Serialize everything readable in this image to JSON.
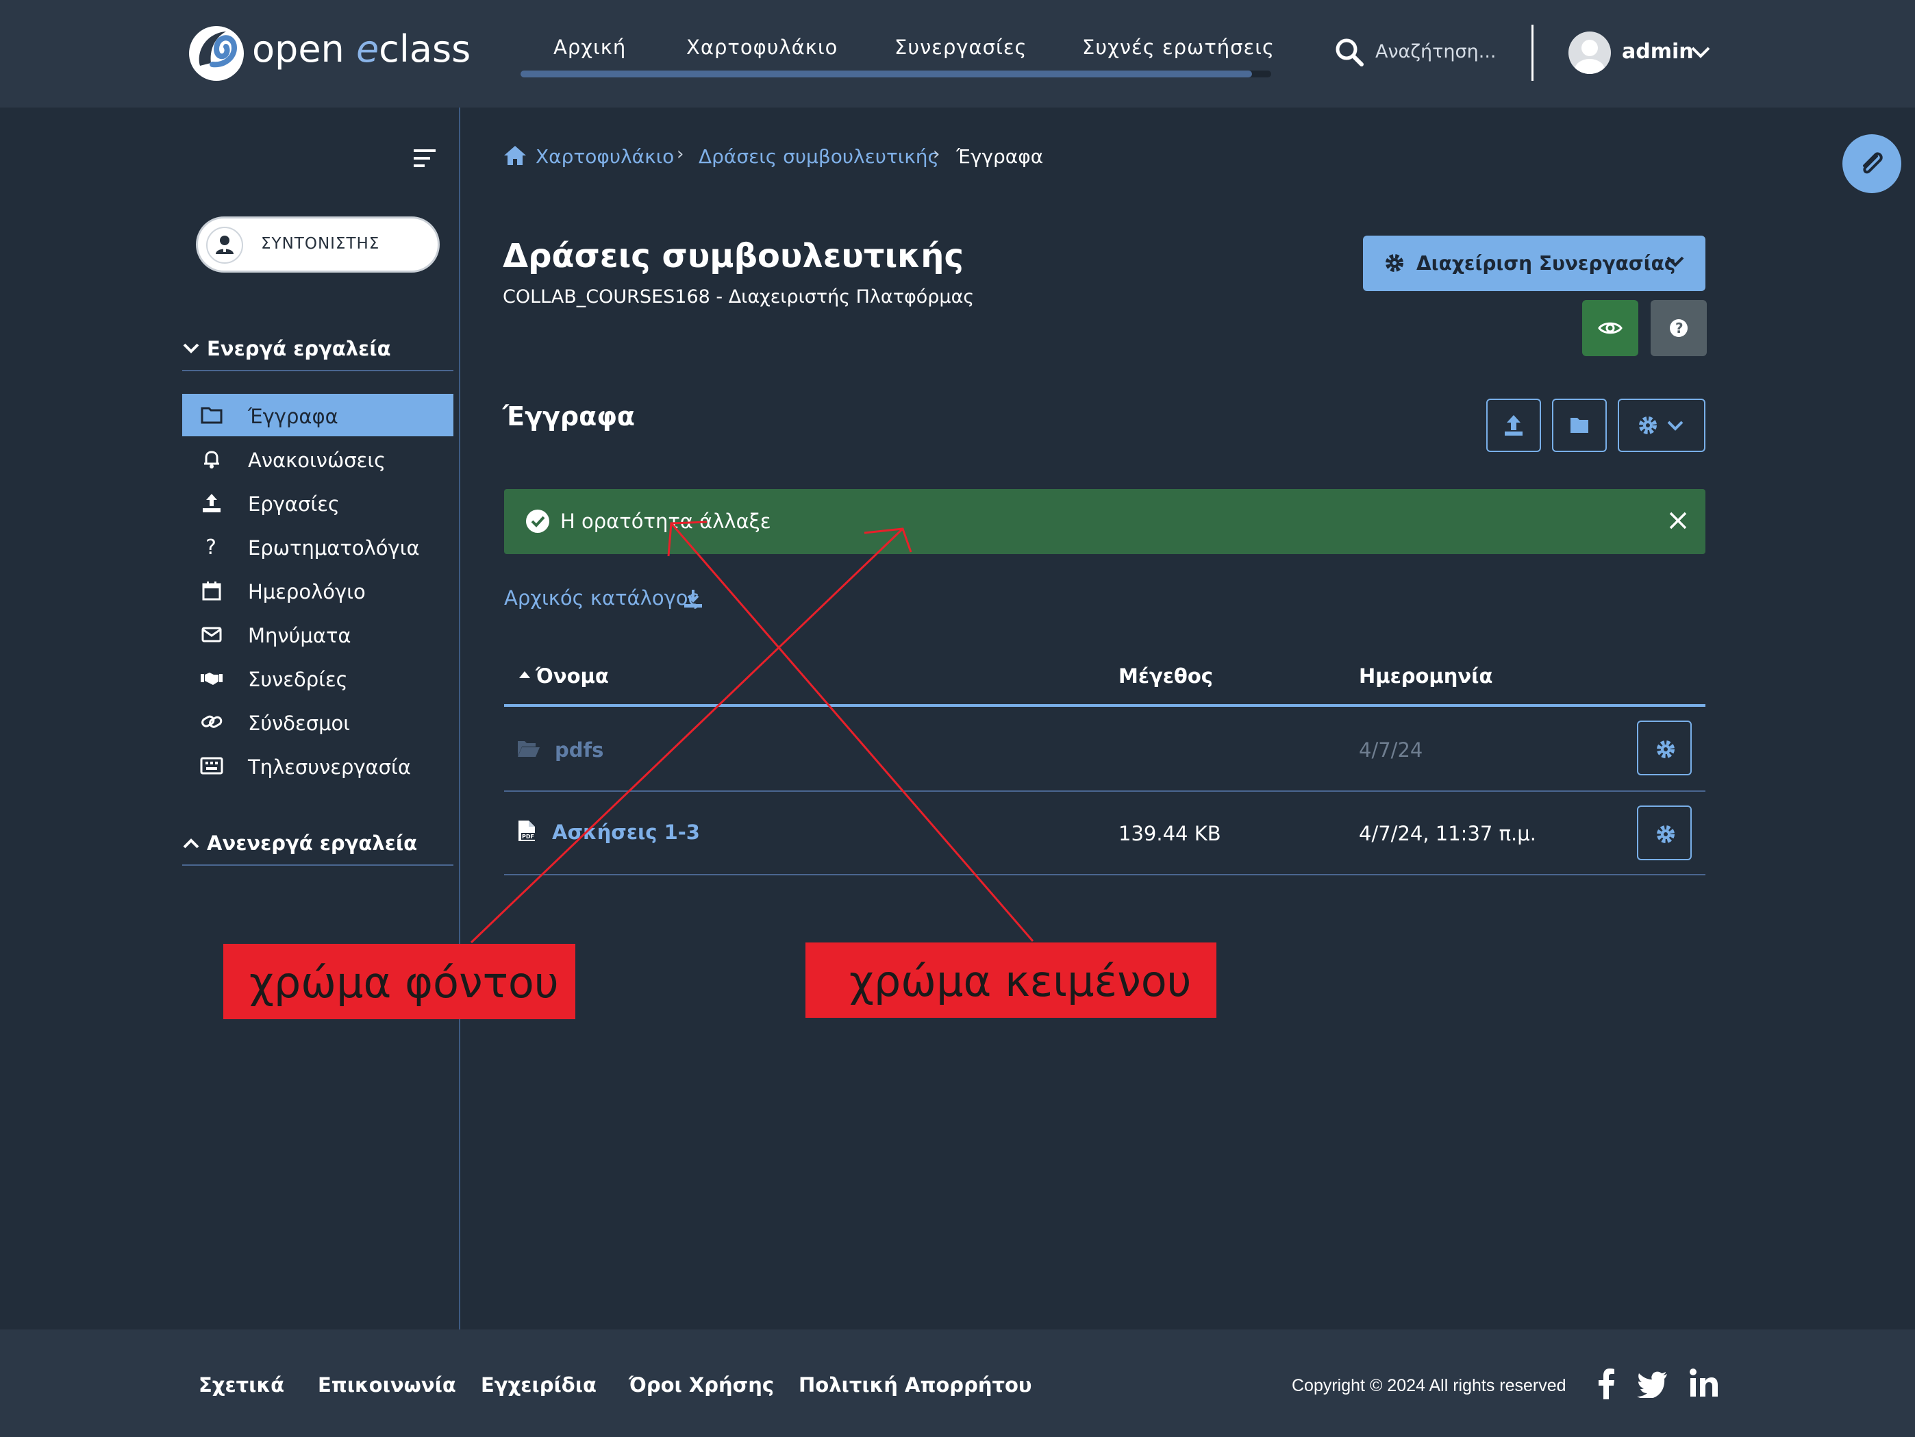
{
  "brand": {
    "name_open": "open",
    "name_e": "e",
    "name_class": "class",
    "accent": "#79afe8"
  },
  "topnav": {
    "items": [
      "Αρχική",
      "Χαρτοφυλάκιο",
      "Συνεργασίες",
      "Συχνές ερωτήσεις"
    ],
    "search_placeholder": "Αναζήτηση...",
    "user": "admin"
  },
  "sidebar": {
    "role": "ΣΥΝΤΟΝΙΣΤΗΣ",
    "active_heading": "Ενεργά εργαλεία",
    "inactive_heading": "Ανενεργά εργαλεία",
    "items": [
      {
        "label": "Έγγραφα",
        "icon": "folder-icon",
        "active": true
      },
      {
        "label": "Ανακοινώσεις",
        "icon": "bell-icon"
      },
      {
        "label": "Εργασίες",
        "icon": "upload-icon"
      },
      {
        "label": "Ερωτηματολόγια",
        "icon": "question-icon"
      },
      {
        "label": "Ημερολόγιο",
        "icon": "calendar-icon"
      },
      {
        "label": "Μηνύματα",
        "icon": "envelope-icon"
      },
      {
        "label": "Συνεδρίες",
        "icon": "handshake-icon"
      },
      {
        "label": "Σύνδεσμοι",
        "icon": "link-icon"
      },
      {
        "label": "Τηλεσυνεργασία",
        "icon": "keyboard-icon"
      }
    ]
  },
  "breadcrumb": [
    "Χαρτοφυλάκιο",
    "Δράσεις συμβουλευτικής",
    "Έγγραφα"
  ],
  "page": {
    "title": "Δράσεις συμβουλευτικής",
    "subtitle": "COLLAB_COURSES168  -  Διαχειριστής Πλατφόρμας",
    "manage_label": "Διαχείριση Συνεργασίας",
    "section_title": "Έγγραφα"
  },
  "alert": {
    "message": "Η ορατότητα άλλαξε",
    "color": "#336b44"
  },
  "root_link": "Αρχικός κατάλογος",
  "table": {
    "columns": [
      "Όνομα",
      "Μέγεθος",
      "Ημερομηνία"
    ],
    "rows": [
      {
        "name": "pdfs",
        "size": "",
        "date": "4/7/24",
        "type": "folder"
      },
      {
        "name": "Ασκήσεις 1-3",
        "size": "139.44 KB",
        "date": "4/7/24, 11:37 π.μ.",
        "type": "pdf"
      }
    ]
  },
  "annotations": {
    "background": "χρώμα φόντου",
    "text": "χρώμα κειμένου"
  },
  "footer": {
    "links": [
      "Σχετικά",
      "Επικοινωνία",
      "Εγχειρίδια",
      "Όροι Χρήσης",
      "Πολιτική Απορρήτου"
    ],
    "copyright": "Copyright © 2024 All rights reserved"
  }
}
